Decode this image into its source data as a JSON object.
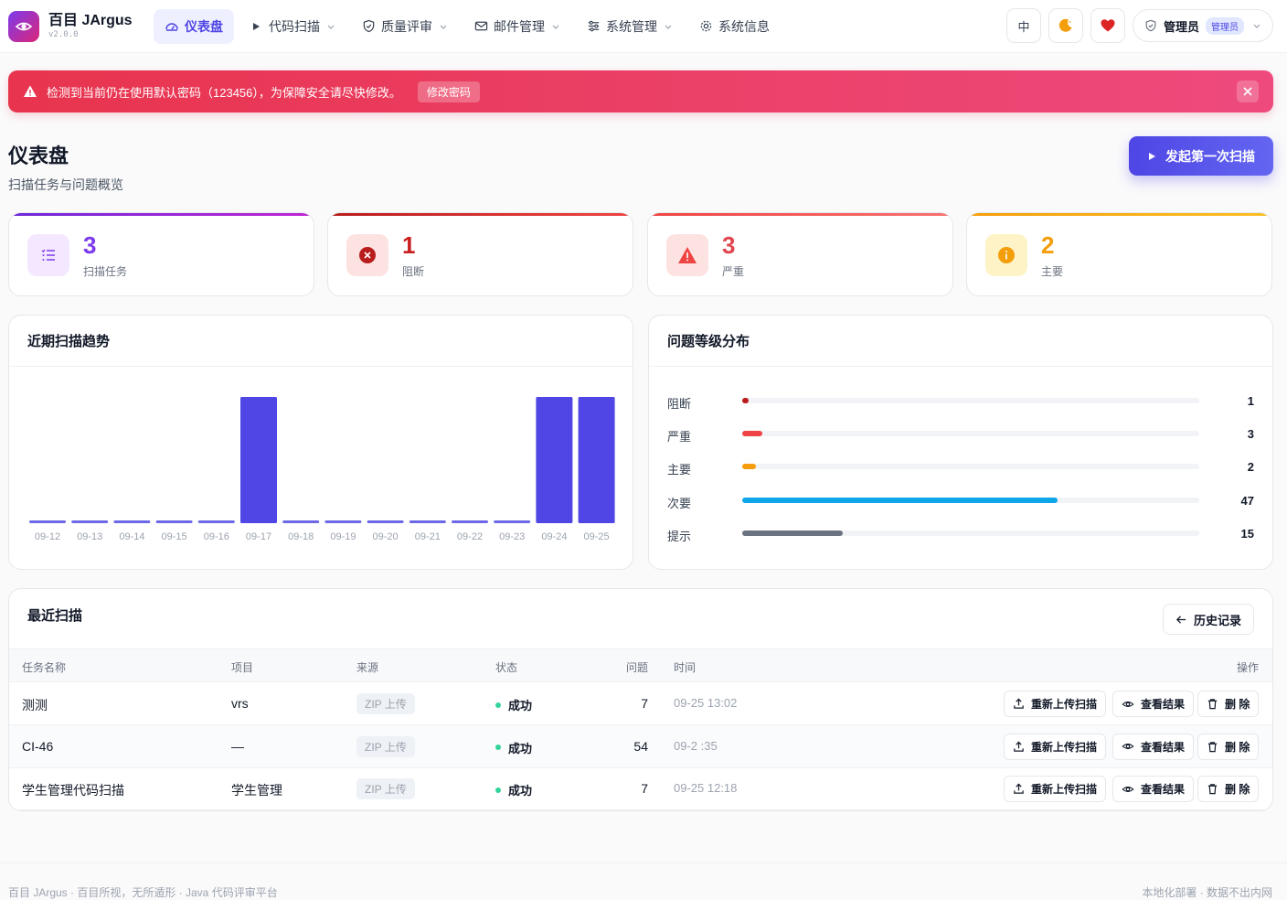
{
  "app": {
    "name": "百目 JArgus",
    "version": "v2.0.0"
  },
  "nav": {
    "items": [
      {
        "label": "仪表盘",
        "icon": "dashboard-icon",
        "active": true
      },
      {
        "label": "代码扫描",
        "icon": "play-icon",
        "dropdown": true
      },
      {
        "label": "质量评审",
        "icon": "shield-icon",
        "dropdown": true
      },
      {
        "label": "邮件管理",
        "icon": "mail-icon",
        "dropdown": true
      },
      {
        "label": "系统管理",
        "icon": "sliders-icon",
        "dropdown": true
      },
      {
        "label": "系统信息",
        "icon": "gear-icon",
        "dropdown": false
      }
    ],
    "lang": "中",
    "user": {
      "name": "管理员",
      "role": "管理员"
    }
  },
  "alert": {
    "message": "检测到当前仍在使用默认密码（123456），为保障安全请尽快修改。",
    "action": "修改密码"
  },
  "header": {
    "title": "仪表盘",
    "subtitle": "扫描任务与问题概览",
    "primary_action": "发起第一次扫描"
  },
  "stats": [
    {
      "value": "3",
      "label": "扫描任务",
      "color": "#7c3aed"
    },
    {
      "value": "1",
      "label": "阻断",
      "color": "#dc2626"
    },
    {
      "value": "3",
      "label": "严重",
      "color": "#ef4444"
    },
    {
      "value": "2",
      "label": "主要",
      "color": "#f59e0b"
    }
  ],
  "trend": {
    "title": "近期扫描趋势"
  },
  "distribution": {
    "title": "问题等级分布",
    "items": [
      {
        "label": "阻断",
        "value": "1",
        "color": "#b91c1c"
      },
      {
        "label": "严重",
        "value": "3",
        "color": "#ef4444"
      },
      {
        "label": "主要",
        "value": "2",
        "color": "#f59e0b"
      },
      {
        "label": "次要",
        "value": "47",
        "color": "#0ea5e9"
      },
      {
        "label": "提示",
        "value": "15",
        "color": "#6b7280"
      }
    ]
  },
  "chart_data": {
    "type": "bar",
    "categories": [
      "09-12",
      "09-13",
      "09-14",
      "09-15",
      "09-16",
      "09-17",
      "09-18",
      "09-19",
      "09-20",
      "09-21",
      "09-22",
      "09-23",
      "09-24",
      "09-25"
    ],
    "values": [
      0,
      0,
      0,
      0,
      0,
      1,
      0,
      0,
      0,
      0,
      0,
      0,
      1,
      1
    ],
    "ylim": [
      0,
      1
    ],
    "grid": false,
    "bar_color": "#4f46e5"
  },
  "recent": {
    "title": "最近扫描",
    "history_button": "历史记录",
    "columns": [
      "任务名称",
      "项目",
      "来源",
      "状态",
      "问题",
      "时间",
      "操作"
    ],
    "rows": [
      {
        "name": "测测",
        "project": "vrs",
        "source": "ZIP 上传",
        "status": "成功",
        "issues": "7",
        "time": "09-25 13:02"
      },
      {
        "name": "CI-46",
        "project": "—",
        "source": "ZIP 上传",
        "status": "成功",
        "issues": "54",
        "time": "09-2  :35"
      },
      {
        "name": "学生管理代码扫描",
        "project": "学生管理",
        "source": "ZIP 上传",
        "status": "成功",
        "issues": "7",
        "time": "09-25 12:18"
      }
    ],
    "actions": {
      "rescan": "重新上传扫描",
      "view": "查看结果",
      "delete": "删 除"
    }
  },
  "footer": {
    "left": "百目 JArgus · 百目所视，无所遁形 · Java 代码评审平台",
    "right": "本地化部署 · 数据不出内网"
  }
}
